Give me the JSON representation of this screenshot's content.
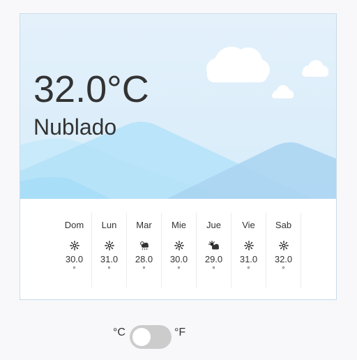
{
  "current": {
    "temperature": "32.0°C",
    "condition": "Nublado"
  },
  "forecast": [
    {
      "day": "Dom",
      "icon": "sun-icon",
      "value": "30.0",
      "unit": "°"
    },
    {
      "day": "Lun",
      "icon": "sun-icon",
      "value": "31.0",
      "unit": "°"
    },
    {
      "day": "Mar",
      "icon": "rain-cloud-icon",
      "value": "28.0",
      "unit": "°"
    },
    {
      "day": "Mie",
      "icon": "sun-icon",
      "value": "30.0",
      "unit": "°"
    },
    {
      "day": "Jue",
      "icon": "partly-cloudy-icon",
      "value": "29.0",
      "unit": "°"
    },
    {
      "day": "Vie",
      "icon": "sun-icon",
      "value": "31.0",
      "unit": "°"
    },
    {
      "day": "Sab",
      "icon": "sun-icon",
      "value": "32.0",
      "unit": "°"
    }
  ],
  "units": {
    "celsius_label": "°C",
    "fahrenheit_label": "°F",
    "fahrenheit_selected": false
  },
  "colors": {
    "sky": "#e4f1fb",
    "mountain_light": "#b9e3f8",
    "mountain_mid": "#a8dcf6",
    "mountain_blue": "#9ccdf0",
    "toggle_off": "#cccccc"
  }
}
